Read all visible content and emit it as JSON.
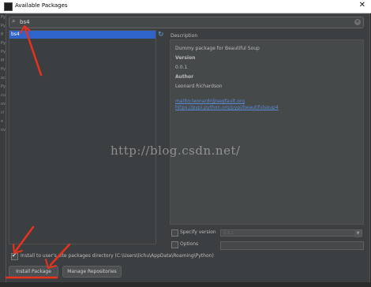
{
  "window": {
    "title": "Available Packages",
    "close_glyph": "✕"
  },
  "search": {
    "value": "bs4",
    "icon": "search-icon",
    "clear_glyph": "×"
  },
  "packages": {
    "items": [
      {
        "label": "bs4",
        "selected": true
      }
    ],
    "refresh_glyph": "↻"
  },
  "description": {
    "label": "Description",
    "summary": "Dummy package for Beautiful Soup",
    "version_heading": "Version",
    "version_value": "0.0.1",
    "author_heading": "Author",
    "author_value": "Leonard Richardson",
    "email_link": "mailto:leonardr@segfault.org",
    "pypi_link": "https://pypi.python.org/pypi/beautifulsoup4"
  },
  "options": {
    "specify_version_label": "Specify version",
    "specify_version_value": "0.0.1",
    "specify_version_checked": false,
    "options_label": "Options",
    "options_checked": false
  },
  "install_to_user": {
    "label": "Install to user's site packages directory (C:\\Users\\lichu\\AppData\\Roaming\\Python)",
    "checked": true
  },
  "buttons": {
    "install": "Install Package",
    "manage": "Manage Repositories"
  },
  "watermark": "http://blog.csdn.net/",
  "left_strip_text": [
    "Py",
    "Py",
    "fl",
    "Py",
    "Py",
    "M",
    "Py",
    "ac",
    "Py",
    "cu",
    "ov",
    "cl",
    "o",
    "ov"
  ],
  "colors": {
    "selection": "#2f65ca",
    "annotation": "#e8321e",
    "link": "#5b8bd6"
  }
}
